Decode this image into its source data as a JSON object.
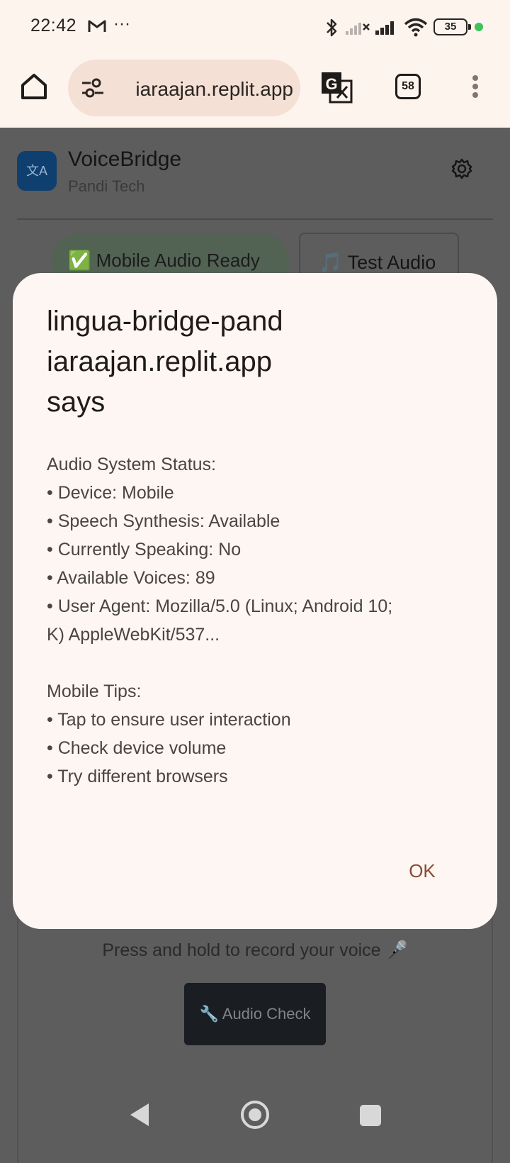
{
  "status_bar": {
    "time": "22:42",
    "dots": "···",
    "battery": "35",
    "icons": [
      "gmail-icon",
      "bluetooth-icon",
      "signal-icon",
      "wifi-icon",
      "battery-icon"
    ]
  },
  "browser": {
    "url": "iaraajan.replit.app",
    "tab_count": "58"
  },
  "app": {
    "logo_glyph": "文A",
    "title": "VoiceBridge",
    "subtitle": "Pandi Tech",
    "ready_pill": "✅ Mobile Audio Ready",
    "test_audio": "🎵 Test Audio",
    "hold_text": "Press and hold to record your voice 🎤",
    "audio_check": "🔧 Audio Check"
  },
  "dialog": {
    "title_lines": [
      "lingua-bridge-pand",
      "iaraajan.replit.app",
      "says"
    ],
    "body_lines": [
      "Audio System Status:",
      "• Device: Mobile",
      "• Speech Synthesis: Available",
      "• Currently Speaking: No",
      "• Available Voices: 89",
      "• User Agent: Mozilla/5.0 (Linux; Android 10;",
      "K) AppleWebKit/537...",
      "",
      "Mobile Tips:",
      "• Tap to ensure user interaction",
      "• Check device volume",
      "• Try different browsers"
    ],
    "ok_label": "OK"
  },
  "colors": {
    "accent": "#8b4a30",
    "overlay": "#5d5d5d",
    "dialog_bg": "#fdf6f3"
  }
}
